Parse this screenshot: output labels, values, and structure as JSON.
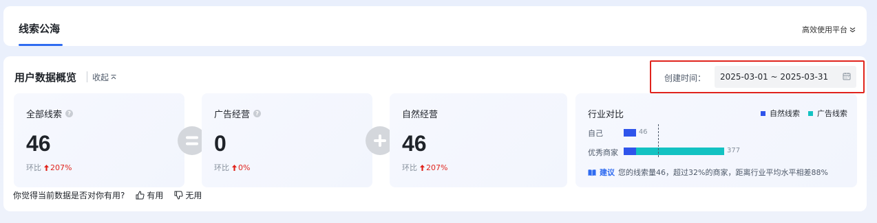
{
  "header": {
    "tab_label": "线索公海",
    "platform_link": "高效使用平台"
  },
  "overview": {
    "title": "用户数据概览",
    "collapse_label": "收起",
    "date_label": "创建时间：",
    "date_range": "2025-03-01 ~ 2025-03-31"
  },
  "stats": [
    {
      "label": "全部线索",
      "value": "46",
      "ratio_label": "环比",
      "ratio": "207%"
    },
    {
      "label": "广告经营",
      "value": "0",
      "ratio_label": "环比",
      "ratio": "0%"
    },
    {
      "label": "自然经营",
      "value": "46",
      "ratio_label": "环比",
      "ratio": "207%"
    }
  ],
  "industry": {
    "title": "行业对比",
    "legend": [
      {
        "name": "自然线索",
        "color": "#2f54eb"
      },
      {
        "name": "广告线索",
        "color": "#13c2c2"
      }
    ],
    "rows": [
      {
        "label": "自己",
        "natural": 46,
        "ad": 0,
        "total_label": "46"
      },
      {
        "label": "优秀商家",
        "natural": 46,
        "ad": 331,
        "total_label": "377"
      }
    ],
    "suggest_tag": "建议",
    "suggest_text": "您的线索量46，超过32%的商家，距离行业平均水平相差88%"
  },
  "feedback": {
    "question": "你觉得当前数据是否对你有用?",
    "useful": "有用",
    "useless": "无用"
  },
  "colors": {
    "accent": "#2f6bf0",
    "up_red": "#e0231c",
    "natural": "#2f54eb",
    "ad": "#13c2c2"
  }
}
